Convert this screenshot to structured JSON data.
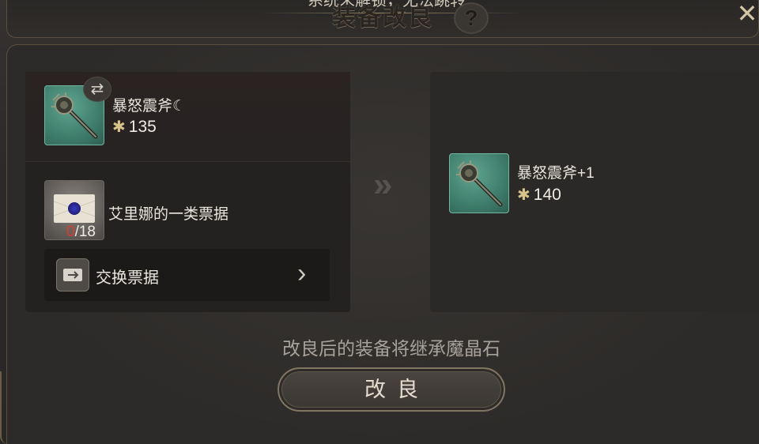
{
  "header": {
    "notice": "系统未解锁，无法跳转",
    "title": "装备改良",
    "help_symbol": "?",
    "close_symbol": "✕"
  },
  "source_item": {
    "name": "暴怒震斧",
    "name_suffix_icon": "crescent-icon",
    "power": "135",
    "swap_symbol": "⇄"
  },
  "material": {
    "name": "艾里娜的一类票据",
    "owned": "0",
    "required": "/18"
  },
  "exchange": {
    "label": "交换票据",
    "chevron": "›"
  },
  "transfer_arrows": "»",
  "result_item": {
    "name": "暴怒震斧+1",
    "power": "140"
  },
  "info_text": "改良后的装备将继承魔晶石",
  "refine_button": "改良",
  "colors": {
    "accent_gold": "#d8c489",
    "count_red": "#e03a30",
    "item_teal": "#3f7d6b"
  }
}
